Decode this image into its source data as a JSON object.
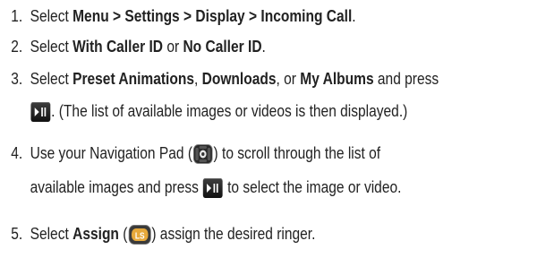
{
  "steps": [
    {
      "number": "1.",
      "parts": [
        "Select ",
        "Menu > Settings > Display > Incoming Call",
        "."
      ]
    },
    {
      "number": "2.",
      "parts": [
        "Select ",
        "With Caller ID",
        " or ",
        "No Caller ID",
        "."
      ]
    },
    {
      "number": "3.",
      "parts": [
        "Select ",
        "Preset Animations",
        ", ",
        "Downloads",
        ", or ",
        "My Albums",
        " and press"
      ],
      "cont": ". (The list of available images or videos is then displayed.)"
    },
    {
      "number": "4.",
      "parts": [
        "Use your Navigation Pad (",
        ") to scroll through the list of"
      ],
      "cont": [
        "available images and press ",
        " to select the image or video."
      ]
    },
    {
      "number": "5.",
      "parts": [
        "Select ",
        "Assign",
        " (",
        ") assign the desired ringer."
      ]
    }
  ],
  "icons": {
    "play_pause_button": "play-pause-icon",
    "navigation_pad": "navigation-pad-icon",
    "left_soft_key": "left-soft-key-icon",
    "left_soft_key_label": "LS"
  },
  "colors": {
    "text": "#222222",
    "button_bg": "#1a1a1a",
    "soft_key": "#e6a83a"
  }
}
